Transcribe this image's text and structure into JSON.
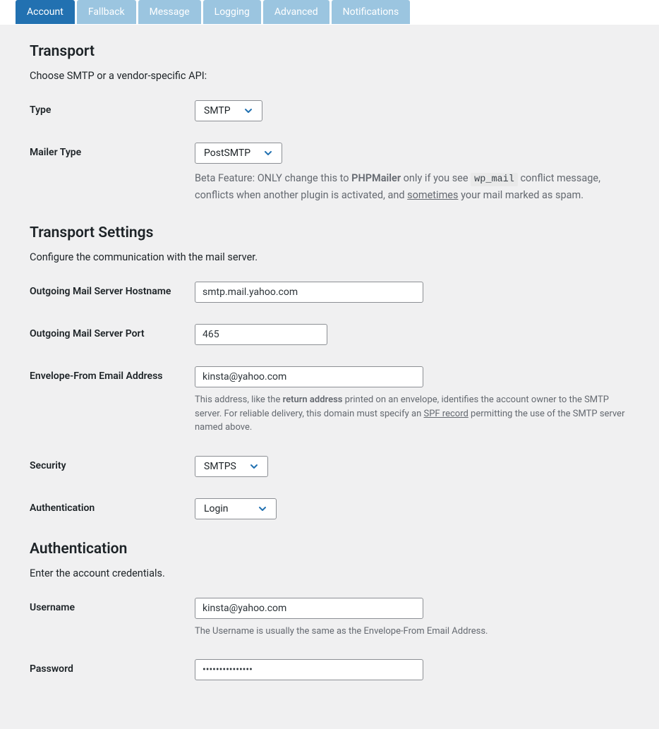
{
  "tabs": [
    {
      "label": "Account",
      "active": true
    },
    {
      "label": "Fallback",
      "active": false
    },
    {
      "label": "Message",
      "active": false
    },
    {
      "label": "Logging",
      "active": false
    },
    {
      "label": "Advanced",
      "active": false
    },
    {
      "label": "Notifications",
      "active": false
    }
  ],
  "transport": {
    "heading": "Transport",
    "desc": "Choose SMTP or a vendor-specific API:",
    "type_label": "Type",
    "type_value": "SMTP",
    "mailer_type_label": "Mailer Type",
    "mailer_type_value": "PostSMTP",
    "mailer_help_pre": "Beta Feature: ONLY change this to ",
    "mailer_help_bold": "PHPMailer",
    "mailer_help_mid": " only if you see ",
    "mailer_help_code": "wp_mail",
    "mailer_help_after": " conflict message, conflicts when another plugin is activated, and ",
    "mailer_help_link": "sometimes",
    "mailer_help_end": " your mail marked as spam."
  },
  "settings": {
    "heading": "Transport Settings",
    "desc": "Configure the communication with the mail server.",
    "hostname_label": "Outgoing Mail Server Hostname",
    "hostname_value": "smtp.mail.yahoo.com",
    "port_label": "Outgoing Mail Server Port",
    "port_value": "465",
    "envelope_label": "Envelope-From Email Address",
    "envelope_value": "kinsta@yahoo.com",
    "envelope_help_pre": "This address, like the ",
    "envelope_help_bold": "return address",
    "envelope_help_mid": " printed on an envelope, identifies the account owner to the SMTP server. For reliable delivery, this domain must specify an ",
    "envelope_help_link": "SPF record",
    "envelope_help_end": " permitting the use of the SMTP server named above.",
    "security_label": "Security",
    "security_value": "SMTPS",
    "auth_label": "Authentication",
    "auth_value": "Login"
  },
  "auth": {
    "heading": "Authentication",
    "desc": "Enter the account credentials.",
    "username_label": "Username",
    "username_value": "kinsta@yahoo.com",
    "username_help": "The Username is usually the same as the Envelope-From Email Address.",
    "password_label": "Password",
    "password_value": "•••••••••••••••"
  }
}
